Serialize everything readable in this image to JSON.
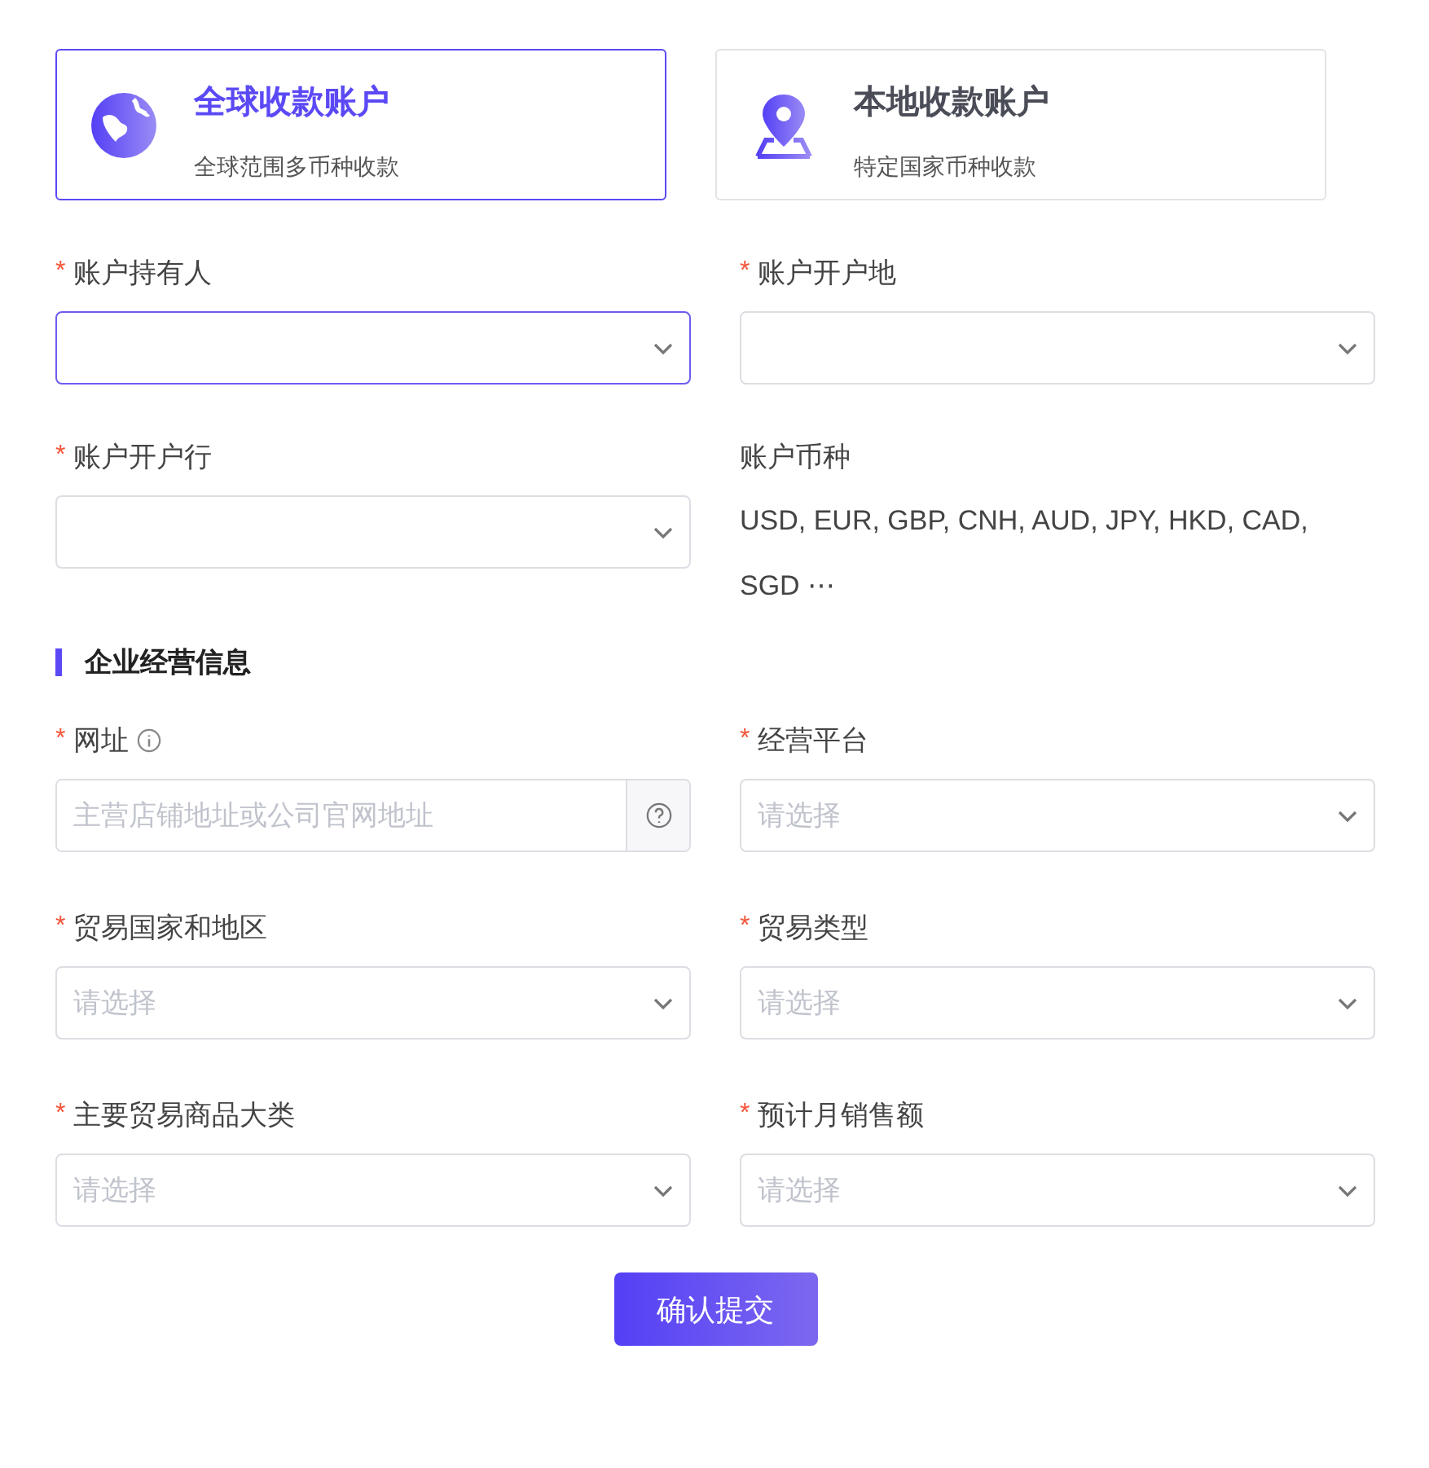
{
  "account_types": [
    {
      "title": "全球收款账户",
      "subtitle": "全球范围多币种收款",
      "selected": true
    },
    {
      "title": "本地收款账户",
      "subtitle": "特定国家币种收款",
      "selected": false
    }
  ],
  "required_mark": "*",
  "account_fields": [
    {
      "kind": "select",
      "label": "账户持有人",
      "required": true,
      "focused": true
    },
    {
      "kind": "select",
      "label": "账户开户地",
      "required": true,
      "focused": false
    },
    {
      "kind": "select",
      "label": "账户开户行",
      "required": true,
      "focused": false
    },
    {
      "kind": "text",
      "label": "账户币种",
      "required": false,
      "value": "USD, EUR, GBP, CNH, AUD, JPY, HKD, CAD, SGD ⋯"
    }
  ],
  "section_title": "企业经营信息",
  "business_fields": [
    {
      "kind": "url",
      "label": "网址",
      "required": true,
      "placeholder": "主营店铺地址或公司官网地址"
    },
    {
      "kind": "select",
      "label": "经营平台",
      "required": true,
      "placeholder": "请选择",
      "focused": false
    },
    {
      "kind": "select",
      "label": "贸易国家和地区",
      "required": true,
      "placeholder": "请选择",
      "focused": false
    },
    {
      "kind": "select",
      "label": "贸易类型",
      "required": true,
      "placeholder": "请选择",
      "focused": false
    },
    {
      "kind": "select",
      "label": "主要贸易商品大类",
      "required": true,
      "placeholder": "请选择",
      "focused": false
    },
    {
      "kind": "select",
      "label": "预计月销售额",
      "required": true,
      "placeholder": "请选择",
      "focused": false
    }
  ],
  "submit_button": "确认提交"
}
